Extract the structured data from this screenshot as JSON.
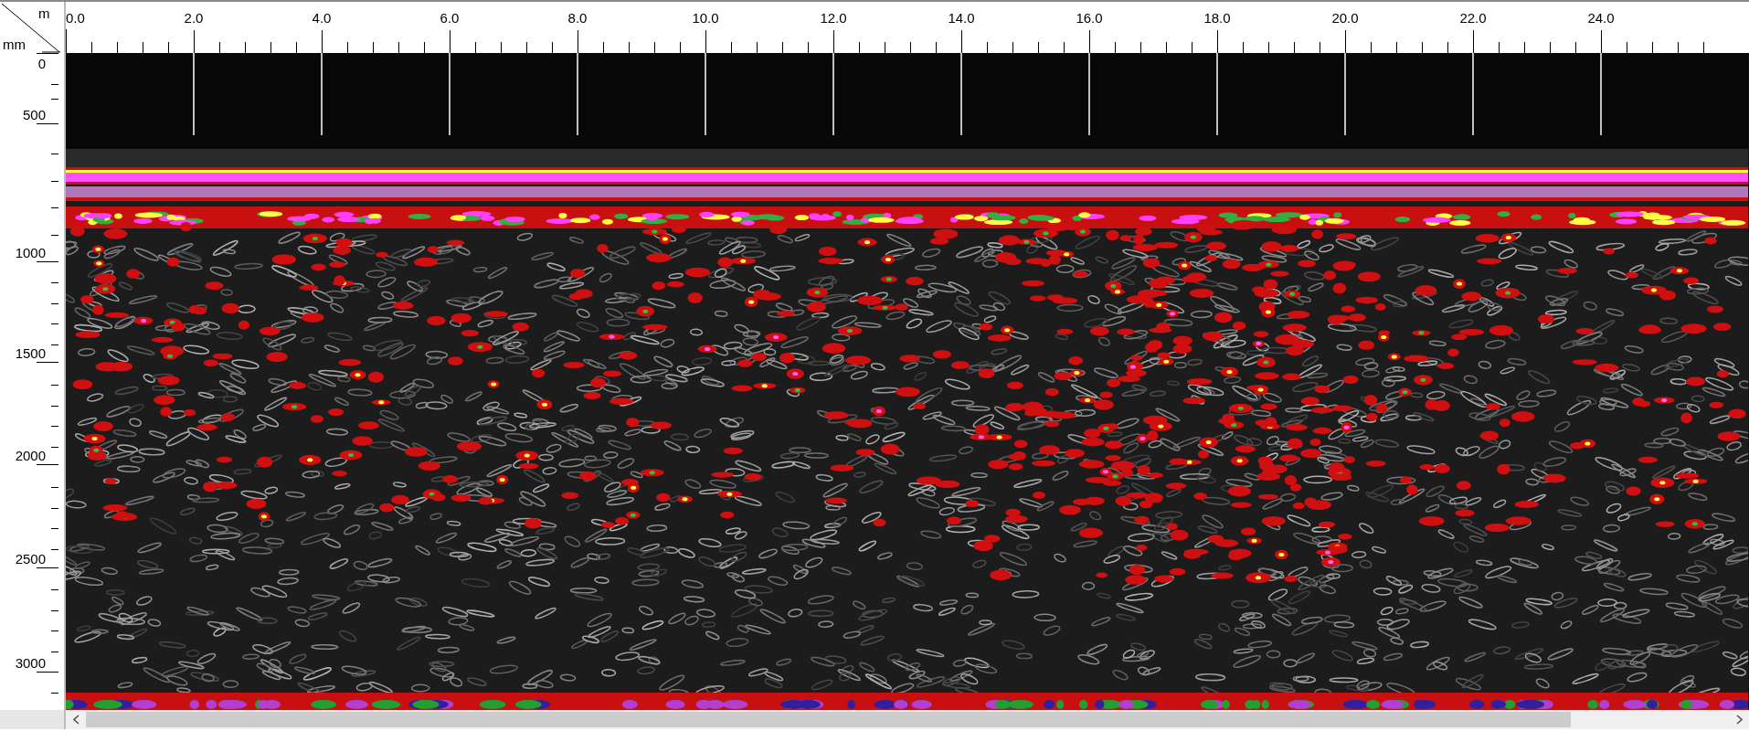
{
  "corner": {
    "x_unit": "m",
    "y_unit": "mm"
  },
  "x_axis": {
    "labels": [
      "0.0",
      "2.0",
      "4.0",
      "6.0",
      "8.0",
      "10.0",
      "12.0",
      "14.0",
      "16.0",
      "18.0",
      "20.0",
      "22.0",
      "24.0"
    ]
  },
  "y_axis": {
    "labels": [
      "0",
      "500",
      "1000",
      "1500",
      "2000",
      "2500",
      "3000"
    ]
  }
}
